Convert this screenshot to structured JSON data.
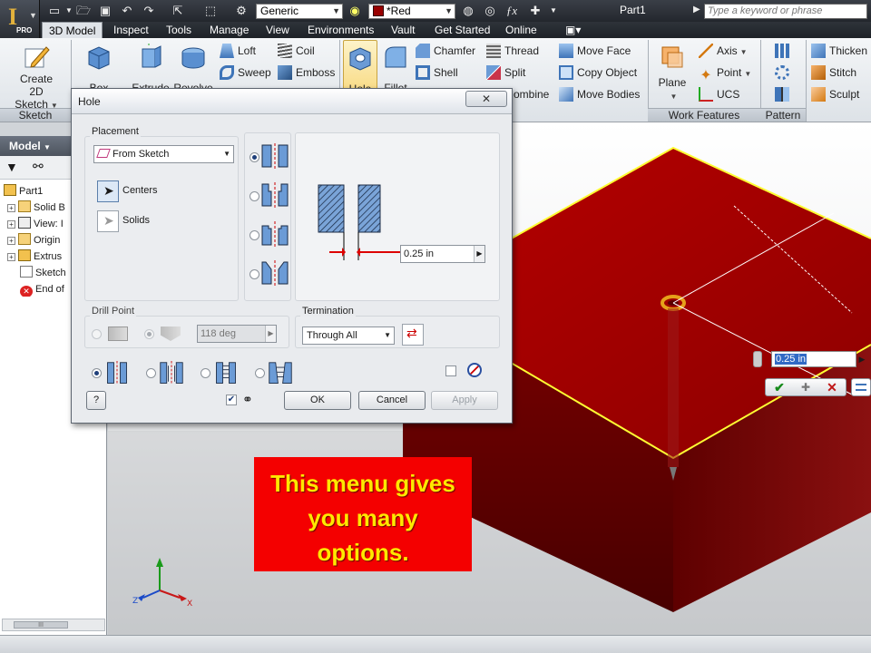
{
  "app": {
    "logo_letter": "I",
    "edition": "PRO",
    "document_title": "Part1"
  },
  "quick_access": {
    "appearance_value": "Generic",
    "material_value": "*Red",
    "search_placeholder": "Type a keyword or phrase"
  },
  "tabs": [
    {
      "label": "3D Model",
      "active": true
    },
    {
      "label": "Inspect"
    },
    {
      "label": "Tools"
    },
    {
      "label": "Manage"
    },
    {
      "label": "View"
    },
    {
      "label": "Environments"
    },
    {
      "label": "Vault"
    },
    {
      "label": "Get Started"
    },
    {
      "label": "Online"
    }
  ],
  "ribbon": {
    "sketch": {
      "create_2d_sketch_line1": "Create",
      "create_2d_sketch_line2": "2D Sketch",
      "panel": "Sketch"
    },
    "create": {
      "box": "Box",
      "extrude": "Extrude",
      "revolve": "Revolve",
      "loft": "Loft",
      "coil": "Coil",
      "sweep": "Sweep",
      "emboss": "Emboss"
    },
    "modify": {
      "hole": "Hole",
      "fillet": "Fillet",
      "chamfer": "Chamfer",
      "thread": "Thread",
      "shell": "Shell",
      "split": "Split",
      "combine_partial": "ombine",
      "move_face": "Move Face",
      "copy_object": "Copy Object",
      "move_bodies": "Move Bodies"
    },
    "work_features": {
      "plane": "Plane",
      "axis": "Axis",
      "point": "Point",
      "ucs": "UCS",
      "panel": "Work Features"
    },
    "pattern": {
      "panel": "Pattern"
    },
    "surface": {
      "thicken": "Thicken",
      "stitch": "Stitch",
      "sculpt": "Sculpt"
    }
  },
  "browser": {
    "header": "Model",
    "items": [
      {
        "label": "Part1"
      },
      {
        "label": "Solid B"
      },
      {
        "label": "View: I"
      },
      {
        "label": "Origin"
      },
      {
        "label": "Extrus"
      },
      {
        "label": "Sketch"
      },
      {
        "label": "End of"
      }
    ],
    "scroll_grip": "III"
  },
  "dialog": {
    "title": "Hole",
    "close_glyph": "✕",
    "placement": {
      "title": "Placement",
      "type": "From Sketch",
      "centers": "Centers",
      "solids": "Solids"
    },
    "diameter": "0.25 in",
    "drill_point": {
      "title": "Drill Point",
      "angle": "118 deg"
    },
    "termination": {
      "title": "Termination",
      "value": "Through All"
    },
    "buttons": {
      "ok": "OK",
      "cancel": "Cancel",
      "apply": "Apply",
      "help": "?"
    }
  },
  "canvas": {
    "input_value": "0.25 in"
  },
  "callout": {
    "line1": "This menu gives",
    "line2": "you many",
    "line3": "options."
  },
  "colors": {
    "part_top": "#a80000",
    "part_side": "#6b0000",
    "edge_highlight": "#ffff33",
    "callout_bg": "#f40000",
    "callout_text": "#ffe800"
  }
}
